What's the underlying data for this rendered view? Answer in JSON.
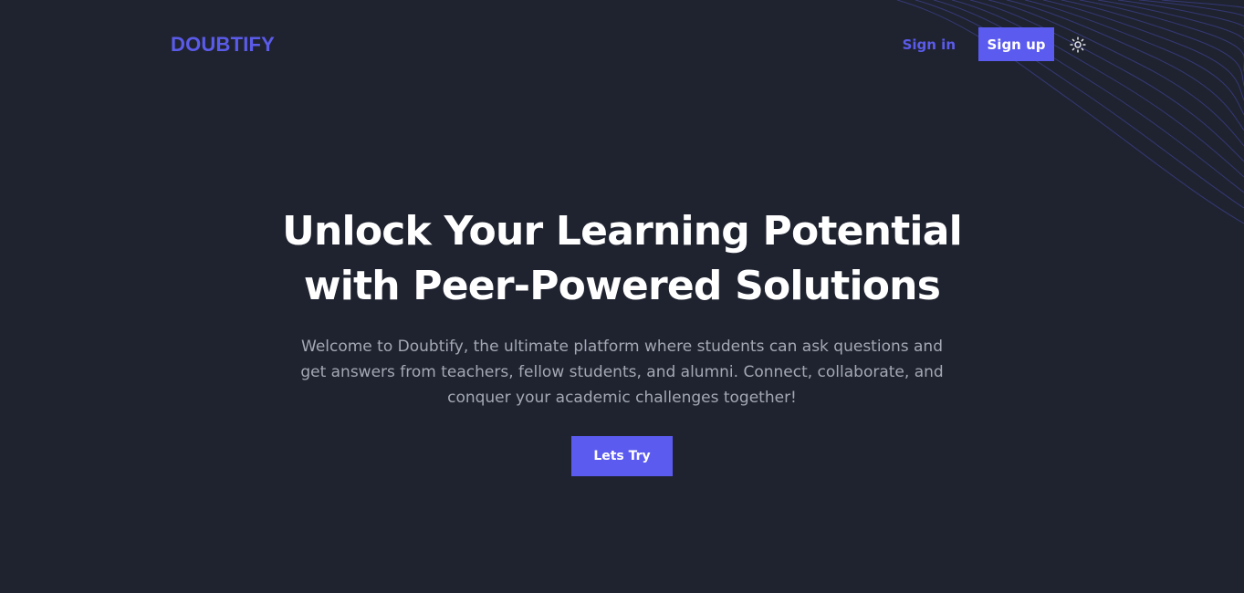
{
  "header": {
    "logo": "DOUBTIFY",
    "signin_label": "Sign in",
    "signup_label": "Sign up",
    "theme_icon": "sun-icon"
  },
  "hero": {
    "title": "Unlock Your Learning Potential with Peer-Powered Solutions",
    "subtitle": "Welcome to Doubtify, the ultimate platform where students can ask questions and get answers from teachers, fellow students, and alumni. Connect, collaborate, and conquer your academic challenges together!",
    "cta_label": "Lets Try"
  },
  "colors": {
    "background": "#1f2330",
    "accent": "#5b5bf0",
    "text_primary": "#ffffff",
    "text_secondary": "#a3a8b4"
  }
}
